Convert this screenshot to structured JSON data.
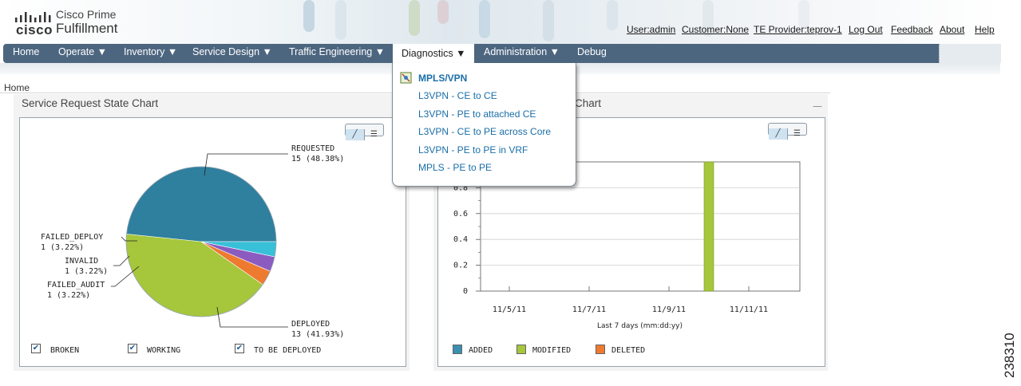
{
  "brand": {
    "line1": "Cisco Prime",
    "line2": "Fulfillment",
    "cisco": "cisco"
  },
  "top_links": [
    "User:admin",
    "Customer:None",
    "TE Provider:teprov-1",
    "Log Out",
    "Feedback",
    "About",
    "Help"
  ],
  "nav": {
    "home": "Home",
    "operate": "Operate ▼",
    "inventory": "Inventory ▼",
    "service_design": "Service Design ▼",
    "traffic_eng": "Traffic Engineering ▼",
    "diagnostics": "Diagnostics ▼",
    "administration": "Administration ▼",
    "debug": "Debug"
  },
  "breadcrumb": "Home",
  "dropdown": {
    "header": "MPLS/VPN",
    "items": [
      "L3VPN - CE to CE",
      "L3VPN - PE to attached CE",
      "L3VPN - CE to PE across Core",
      "L3VPN - PE to PE in VRF",
      "MPLS - PE to PE"
    ]
  },
  "left_panel": {
    "title": "Service Request State Chart",
    "checkboxes": [
      "BROKEN",
      "WORKING",
      "TO BE DEPLOYED"
    ]
  },
  "right_panel": {
    "title_partial": "Chart",
    "minimize": "—",
    "legend": [
      "ADDED",
      "MODIFIED",
      "DELETED"
    ]
  },
  "figure_number": "238310",
  "colors": {
    "nav_bg": "#4d6680",
    "link": "#1a6ea8",
    "requested": "#2f7f9e",
    "deployed": "#a6c63c",
    "failed_deploy": "#38c0d8",
    "invalid": "#8b5bbf",
    "failed_audit": "#ee7a30"
  },
  "chart_data": [
    {
      "type": "pie",
      "title": "Service Request State Chart",
      "slices": [
        {
          "name": "REQUESTED",
          "count": 15,
          "percent": "48.38%",
          "color": "#2f7f9e"
        },
        {
          "name": "DEPLOYED",
          "count": 13,
          "percent": "41.93%",
          "color": "#a6c63c"
        },
        {
          "name": "FAILED_AUDIT",
          "count": 1,
          "percent": "3.22%",
          "color": "#ee7a30"
        },
        {
          "name": "INVALID",
          "count": 1,
          "percent": "3.22%",
          "color": "#8b5bbf"
        },
        {
          "name": "FAILED_DEPLOY",
          "count": 1,
          "percent": "3.22%",
          "color": "#38c0d8"
        }
      ]
    },
    {
      "type": "bar",
      "xlabel": "Last 7 days (mm:dd:yy)",
      "ylabel": "",
      "ylim": [
        0,
        1
      ],
      "yticks": [
        "0",
        "0.2",
        "0.4",
        "0.6",
        "0.8"
      ],
      "categories": [
        "11/5/11",
        "11/7/11",
        "11/9/11",
        "11/11/11"
      ],
      "series": [
        {
          "name": "ADDED",
          "color": "#3b8fb0",
          "values": []
        },
        {
          "name": "MODIFIED",
          "color": "#a6c63c",
          "values": [
            {
              "x": "11/10/11",
              "y": 1
            }
          ]
        },
        {
          "name": "DELETED",
          "color": "#ee7a30",
          "values": []
        }
      ]
    }
  ]
}
